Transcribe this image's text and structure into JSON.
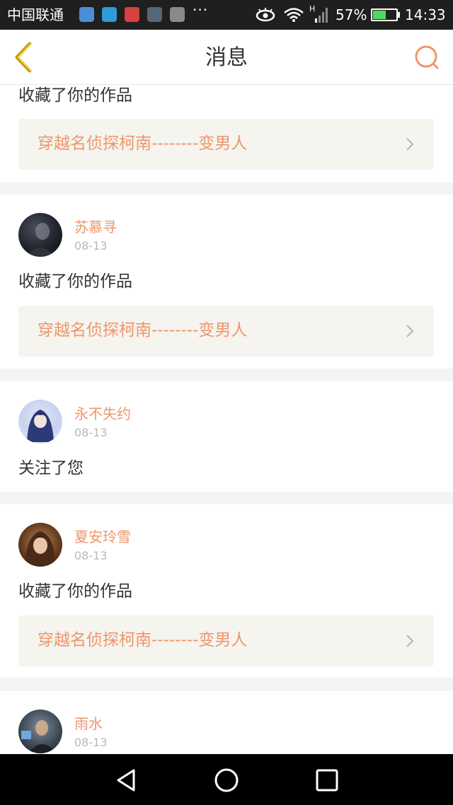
{
  "status_bar": {
    "carrier": "中国联通",
    "more": "···",
    "signal_type": "H",
    "battery": "57%",
    "battery_level": 0.57,
    "time": "14:33"
  },
  "header": {
    "title": "消息",
    "back_icon": "back-chevron-icon",
    "search_icon": "search-icon"
  },
  "colors": {
    "accent": "#f0956a",
    "back_icon": "#c89b1a",
    "background": "#f4f4f4",
    "work_box": "#f5f4ef"
  },
  "messages": [
    {
      "action": "收藏了你的作品",
      "work_title": "穿越名侦探柯南--------变男人"
    },
    {
      "user": "苏慕寻",
      "date": "08-13",
      "action": "收藏了你的作品",
      "work_title": "穿越名侦探柯南--------变男人"
    },
    {
      "user": "永不失约",
      "date": "08-13",
      "action": "关注了您"
    },
    {
      "user": "夏安玲雪",
      "date": "08-13",
      "action": "收藏了你的作品",
      "work_title": "穿越名侦探柯南--------变男人"
    },
    {
      "user": "雨水",
      "date": "08-13"
    }
  ],
  "system_nav": {
    "back_icon": "triangle-back-icon",
    "home_icon": "circle-home-icon",
    "recents_icon": "square-recents-icon"
  }
}
